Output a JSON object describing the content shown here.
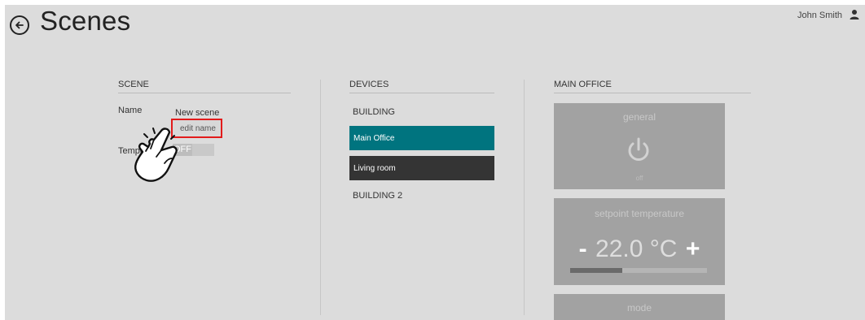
{
  "header": {
    "title": "Scenes",
    "user_name": "John Smith",
    "back_icon": "back-arrow-circle-icon",
    "user_icon": "user-icon"
  },
  "scene": {
    "header": "SCENE",
    "name_label": "Name",
    "name_value": "New scene",
    "edit_name_label": "edit name",
    "temp_label": "Tempo",
    "toggle_value": "OFF"
  },
  "devices": {
    "header": "DEVICES",
    "items": [
      {
        "label": "BUILDING",
        "state": "plain"
      },
      {
        "label": "Main Office",
        "state": "selected"
      },
      {
        "label": "Living room",
        "state": "dark"
      },
      {
        "label": "BUILDING 2",
        "state": "plain"
      }
    ]
  },
  "main_office": {
    "header": "MAIN OFFICE",
    "general": {
      "title": "general",
      "state": "off",
      "icon": "power-icon"
    },
    "setpoint": {
      "title": "setpoint temperature",
      "minus": "-",
      "value": "22.0 °C",
      "plus": "+",
      "level": 0.38
    },
    "mode": {
      "title": "mode"
    }
  },
  "colors": {
    "accent": "#00747f",
    "dark_item": "#343434",
    "tile": "#a2a2a2",
    "highlight": "#e21b1b"
  }
}
